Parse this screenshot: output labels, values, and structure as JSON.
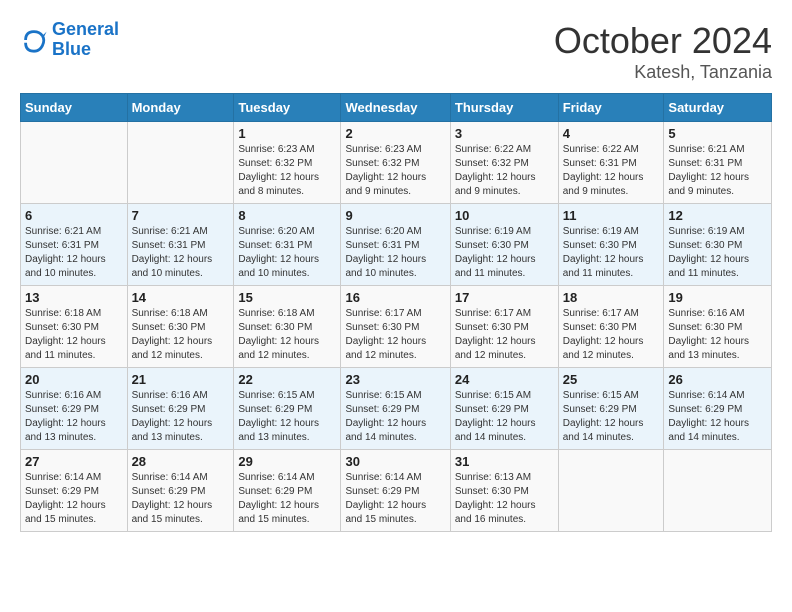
{
  "logo": {
    "line1": "General",
    "line2": "Blue"
  },
  "title": "October 2024",
  "subtitle": "Katesh, Tanzania",
  "days_of_week": [
    "Sunday",
    "Monday",
    "Tuesday",
    "Wednesday",
    "Thursday",
    "Friday",
    "Saturday"
  ],
  "weeks": [
    [
      {
        "day": "",
        "info": ""
      },
      {
        "day": "",
        "info": ""
      },
      {
        "day": "1",
        "info": "Sunrise: 6:23 AM\nSunset: 6:32 PM\nDaylight: 12 hours\nand 8 minutes."
      },
      {
        "day": "2",
        "info": "Sunrise: 6:23 AM\nSunset: 6:32 PM\nDaylight: 12 hours\nand 9 minutes."
      },
      {
        "day": "3",
        "info": "Sunrise: 6:22 AM\nSunset: 6:32 PM\nDaylight: 12 hours\nand 9 minutes."
      },
      {
        "day": "4",
        "info": "Sunrise: 6:22 AM\nSunset: 6:31 PM\nDaylight: 12 hours\nand 9 minutes."
      },
      {
        "day": "5",
        "info": "Sunrise: 6:21 AM\nSunset: 6:31 PM\nDaylight: 12 hours\nand 9 minutes."
      }
    ],
    [
      {
        "day": "6",
        "info": "Sunrise: 6:21 AM\nSunset: 6:31 PM\nDaylight: 12 hours\nand 10 minutes."
      },
      {
        "day": "7",
        "info": "Sunrise: 6:21 AM\nSunset: 6:31 PM\nDaylight: 12 hours\nand 10 minutes."
      },
      {
        "day": "8",
        "info": "Sunrise: 6:20 AM\nSunset: 6:31 PM\nDaylight: 12 hours\nand 10 minutes."
      },
      {
        "day": "9",
        "info": "Sunrise: 6:20 AM\nSunset: 6:31 PM\nDaylight: 12 hours\nand 10 minutes."
      },
      {
        "day": "10",
        "info": "Sunrise: 6:19 AM\nSunset: 6:30 PM\nDaylight: 12 hours\nand 11 minutes."
      },
      {
        "day": "11",
        "info": "Sunrise: 6:19 AM\nSunset: 6:30 PM\nDaylight: 12 hours\nand 11 minutes."
      },
      {
        "day": "12",
        "info": "Sunrise: 6:19 AM\nSunset: 6:30 PM\nDaylight: 12 hours\nand 11 minutes."
      }
    ],
    [
      {
        "day": "13",
        "info": "Sunrise: 6:18 AM\nSunset: 6:30 PM\nDaylight: 12 hours\nand 11 minutes."
      },
      {
        "day": "14",
        "info": "Sunrise: 6:18 AM\nSunset: 6:30 PM\nDaylight: 12 hours\nand 12 minutes."
      },
      {
        "day": "15",
        "info": "Sunrise: 6:18 AM\nSunset: 6:30 PM\nDaylight: 12 hours\nand 12 minutes."
      },
      {
        "day": "16",
        "info": "Sunrise: 6:17 AM\nSunset: 6:30 PM\nDaylight: 12 hours\nand 12 minutes."
      },
      {
        "day": "17",
        "info": "Sunrise: 6:17 AM\nSunset: 6:30 PM\nDaylight: 12 hours\nand 12 minutes."
      },
      {
        "day": "18",
        "info": "Sunrise: 6:17 AM\nSunset: 6:30 PM\nDaylight: 12 hours\nand 12 minutes."
      },
      {
        "day": "19",
        "info": "Sunrise: 6:16 AM\nSunset: 6:30 PM\nDaylight: 12 hours\nand 13 minutes."
      }
    ],
    [
      {
        "day": "20",
        "info": "Sunrise: 6:16 AM\nSunset: 6:29 PM\nDaylight: 12 hours\nand 13 minutes."
      },
      {
        "day": "21",
        "info": "Sunrise: 6:16 AM\nSunset: 6:29 PM\nDaylight: 12 hours\nand 13 minutes."
      },
      {
        "day": "22",
        "info": "Sunrise: 6:15 AM\nSunset: 6:29 PM\nDaylight: 12 hours\nand 13 minutes."
      },
      {
        "day": "23",
        "info": "Sunrise: 6:15 AM\nSunset: 6:29 PM\nDaylight: 12 hours\nand 14 minutes."
      },
      {
        "day": "24",
        "info": "Sunrise: 6:15 AM\nSunset: 6:29 PM\nDaylight: 12 hours\nand 14 minutes."
      },
      {
        "day": "25",
        "info": "Sunrise: 6:15 AM\nSunset: 6:29 PM\nDaylight: 12 hours\nand 14 minutes."
      },
      {
        "day": "26",
        "info": "Sunrise: 6:14 AM\nSunset: 6:29 PM\nDaylight: 12 hours\nand 14 minutes."
      }
    ],
    [
      {
        "day": "27",
        "info": "Sunrise: 6:14 AM\nSunset: 6:29 PM\nDaylight: 12 hours\nand 15 minutes."
      },
      {
        "day": "28",
        "info": "Sunrise: 6:14 AM\nSunset: 6:29 PM\nDaylight: 12 hours\nand 15 minutes."
      },
      {
        "day": "29",
        "info": "Sunrise: 6:14 AM\nSunset: 6:29 PM\nDaylight: 12 hours\nand 15 minutes."
      },
      {
        "day": "30",
        "info": "Sunrise: 6:14 AM\nSunset: 6:29 PM\nDaylight: 12 hours\nand 15 minutes."
      },
      {
        "day": "31",
        "info": "Sunrise: 6:13 AM\nSunset: 6:30 PM\nDaylight: 12 hours\nand 16 minutes."
      },
      {
        "day": "",
        "info": ""
      },
      {
        "day": "",
        "info": ""
      }
    ]
  ]
}
